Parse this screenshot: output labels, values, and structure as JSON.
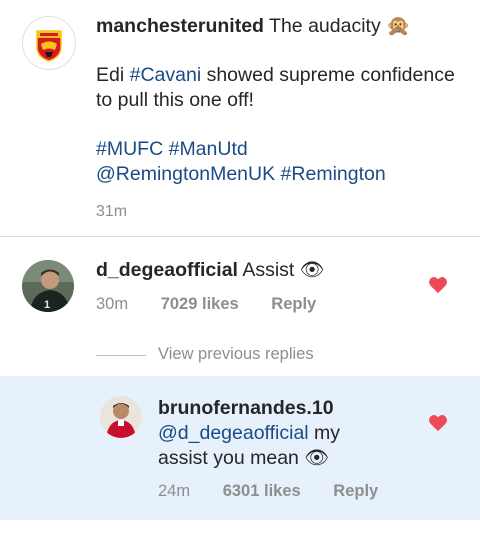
{
  "caption": {
    "username": "manchesterunited",
    "line1_text": "The audacity",
    "emoji": "🙊",
    "para1_a": "Edi ",
    "para1_tag": "#Cavani",
    "para1_b": " showed supreme confidence to pull this one off!",
    "tag1": "#MUFC",
    "tag2": "#ManUtd",
    "tag3": "@RemingtonMenUK",
    "tag4": "#Remington",
    "time": "31m"
  },
  "comment": {
    "username": "d_degeaofficial",
    "text": "Assist",
    "emoji": "👁",
    "time": "30m",
    "likes": "7029 likes",
    "reply_label": "Reply"
  },
  "view_previous": "View previous replies",
  "reply": {
    "username": "brunofernandes.10",
    "mention": "@d_degeaofficial",
    "text_a": " my",
    "text_b": "assist you mean",
    "emoji": "👁",
    "time": "24m",
    "likes": "6301 likes",
    "reply_label": "Reply"
  },
  "colors": {
    "heart": "#ed4956",
    "link": "#1a4b86",
    "highlight_bg": "#e7f1fc"
  }
}
